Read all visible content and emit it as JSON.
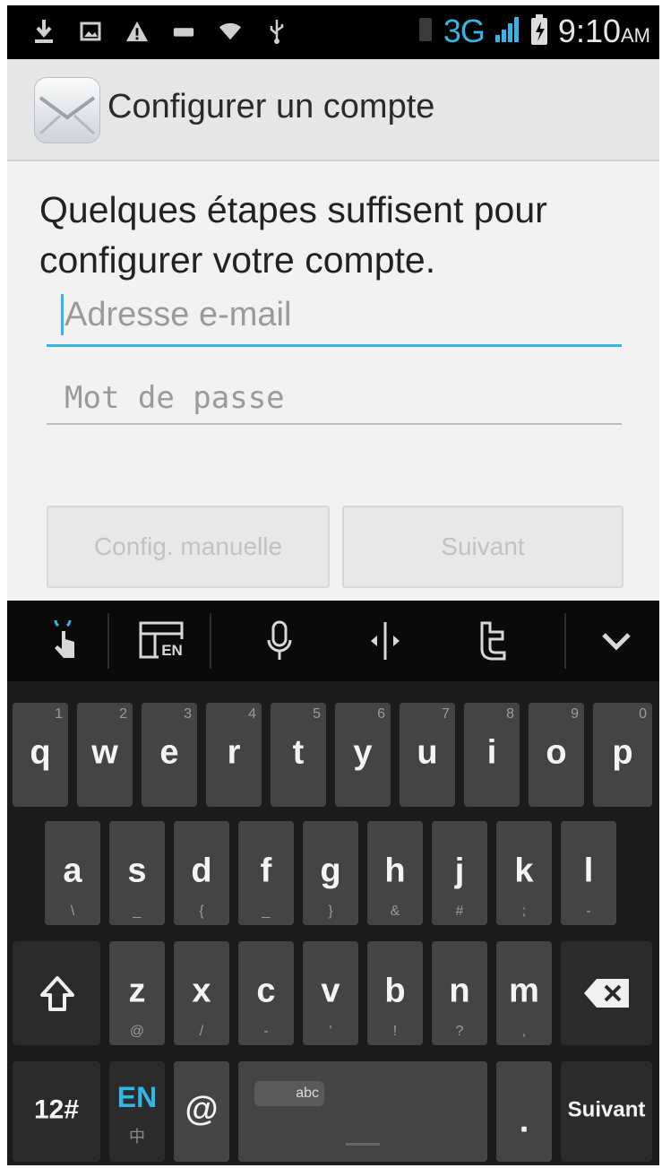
{
  "status_bar": {
    "network": "3G",
    "time": "9:10",
    "ampm": "AM",
    "icons": [
      "download-icon",
      "image-icon",
      "warning-icon",
      "usb-device-icon",
      "wifi-icon",
      "usb-icon"
    ]
  },
  "action_bar": {
    "title": "Configurer un compte",
    "icon": "email-icon"
  },
  "form": {
    "intro": "Quelques étapes suffisent pour configurer votre compte.",
    "email_placeholder": "Adresse e-mail",
    "password_placeholder": "Mot de passe",
    "manual_button": "Config. manuelle",
    "next_button": "Suivant"
  },
  "keyboard_toolbar": {
    "items": [
      "gesture-icon",
      "layout-en-icon",
      "microphone-icon",
      "cursor-icon",
      "twitter-icon",
      "collapse-chevron-icon"
    ],
    "layout_label": "EN"
  },
  "keyboard": {
    "row1": [
      {
        "key": "q",
        "hint": "1"
      },
      {
        "key": "w",
        "hint": "2"
      },
      {
        "key": "e",
        "hint": "3"
      },
      {
        "key": "r",
        "hint": "4"
      },
      {
        "key": "t",
        "hint": "5"
      },
      {
        "key": "y",
        "hint": "6"
      },
      {
        "key": "u",
        "hint": "7"
      },
      {
        "key": "i",
        "hint": "8"
      },
      {
        "key": "o",
        "hint": "9"
      },
      {
        "key": "p",
        "hint": "0"
      }
    ],
    "row2": [
      {
        "key": "a",
        "sub": "\\"
      },
      {
        "key": "s",
        "sub": "_"
      },
      {
        "key": "d",
        "sub": "{"
      },
      {
        "key": "f",
        "sub": "_"
      },
      {
        "key": "g",
        "sub": "}"
      },
      {
        "key": "h",
        "sub": "&"
      },
      {
        "key": "j",
        "sub": "#"
      },
      {
        "key": "k",
        "sub": ";"
      },
      {
        "key": "l",
        "sub": "-"
      }
    ],
    "row3": [
      {
        "key": "z",
        "sub": "@"
      },
      {
        "key": "x",
        "sub": "/"
      },
      {
        "key": "c",
        "sub": "-"
      },
      {
        "key": "v",
        "sub": "'"
      },
      {
        "key": "b",
        "sub": "!"
      },
      {
        "key": "n",
        "sub": "?"
      },
      {
        "key": "m",
        "sub": ","
      }
    ],
    "symbols_key": "12#",
    "lang_key": "EN",
    "lang_key_sub": "中",
    "at_key": "@",
    "space_lang": "abc",
    "period_key": ".",
    "enter_key": "Suivant"
  }
}
